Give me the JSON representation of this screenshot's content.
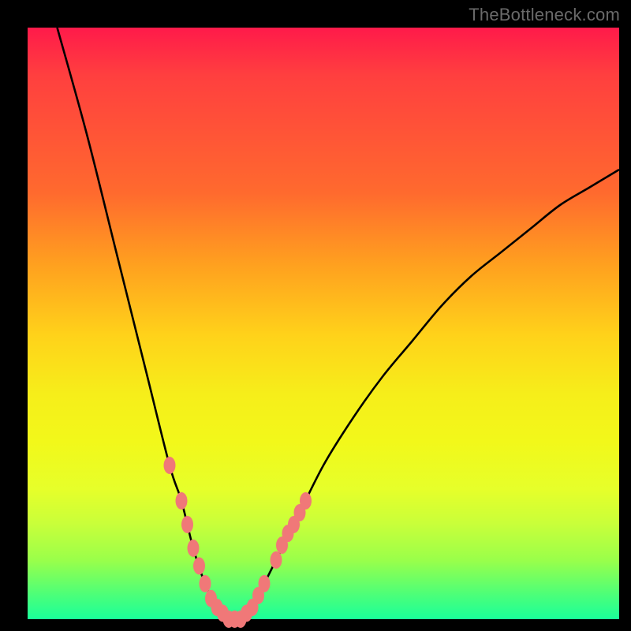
{
  "watermark": "TheBottleneck.com",
  "colors": {
    "background": "#000000",
    "curve": "#000000",
    "marker": "#f07878",
    "watermark": "#6a6a6a"
  },
  "chart_data": {
    "type": "line",
    "title": "",
    "xlabel": "",
    "ylabel": "",
    "xlim": [
      0,
      100
    ],
    "ylim": [
      0,
      100
    ],
    "grid": false,
    "series": [
      {
        "name": "bottleneck-curve",
        "x": [
          5,
          10,
          15,
          20,
          24,
          26,
          28,
          30,
          32,
          34,
          36,
          38,
          40,
          45,
          50,
          55,
          60,
          65,
          70,
          75,
          80,
          85,
          90,
          95,
          100
        ],
        "values": [
          100,
          82,
          62,
          42,
          26,
          20,
          12,
          6,
          2,
          0,
          0,
          2,
          6,
          16,
          26,
          34,
          41,
          47,
          53,
          58,
          62,
          66,
          70,
          73,
          76
        ]
      }
    ],
    "markers": {
      "name": "highlighted-points",
      "x": [
        24,
        26,
        27,
        28,
        29,
        30,
        31,
        32,
        33,
        34,
        35,
        36,
        37,
        38,
        39,
        40,
        42,
        43,
        44,
        45,
        46,
        47
      ],
      "values": [
        26,
        20,
        16,
        12,
        9,
        6,
        3.5,
        2,
        1,
        0,
        0,
        0,
        1,
        2,
        4,
        6,
        10,
        12.5,
        14.5,
        16,
        18,
        20
      ]
    }
  }
}
